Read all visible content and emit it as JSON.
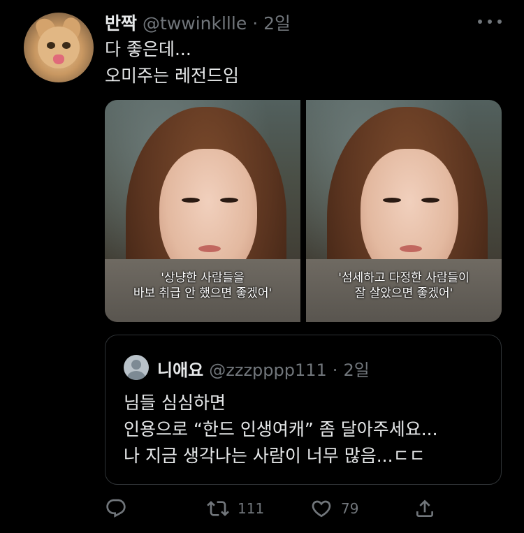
{
  "tweet": {
    "display_name": "반짝",
    "handle": "@twwinkllle",
    "separator": "·",
    "time": "2일",
    "text_lines": [
      "다 좋은데...",
      "오미주는 레전드임"
    ],
    "images": [
      {
        "caption_lines": [
          "'상냥한 사람들을",
          "바보 취급 안 했으면 좋겠어'"
        ]
      },
      {
        "caption_lines": [
          "'섬세하고 다정한 사람들이",
          "잘 살았으면 좋겠어'"
        ]
      }
    ]
  },
  "quoted_tweet": {
    "display_name": "니애요",
    "handle": "@zzzpppp111",
    "separator": "·",
    "time": "2일",
    "text_lines": [
      "님들 심심하면",
      "인용으로 “한드 인생여캐” 좀 달아주세요...",
      "나 지금 생각나는 사람이 너무 많음...ㄷㄷ"
    ]
  },
  "actions": {
    "reply_icon": "reply-icon",
    "retweet_icon": "retweet-icon",
    "retweet_count": "111",
    "like_icon": "heart-icon",
    "like_count": "79",
    "share_icon": "share-icon"
  },
  "colors": {
    "background": "#000000",
    "text_primary": "#e7e9ea",
    "text_secondary": "#71767b",
    "border": "#2f3336"
  }
}
